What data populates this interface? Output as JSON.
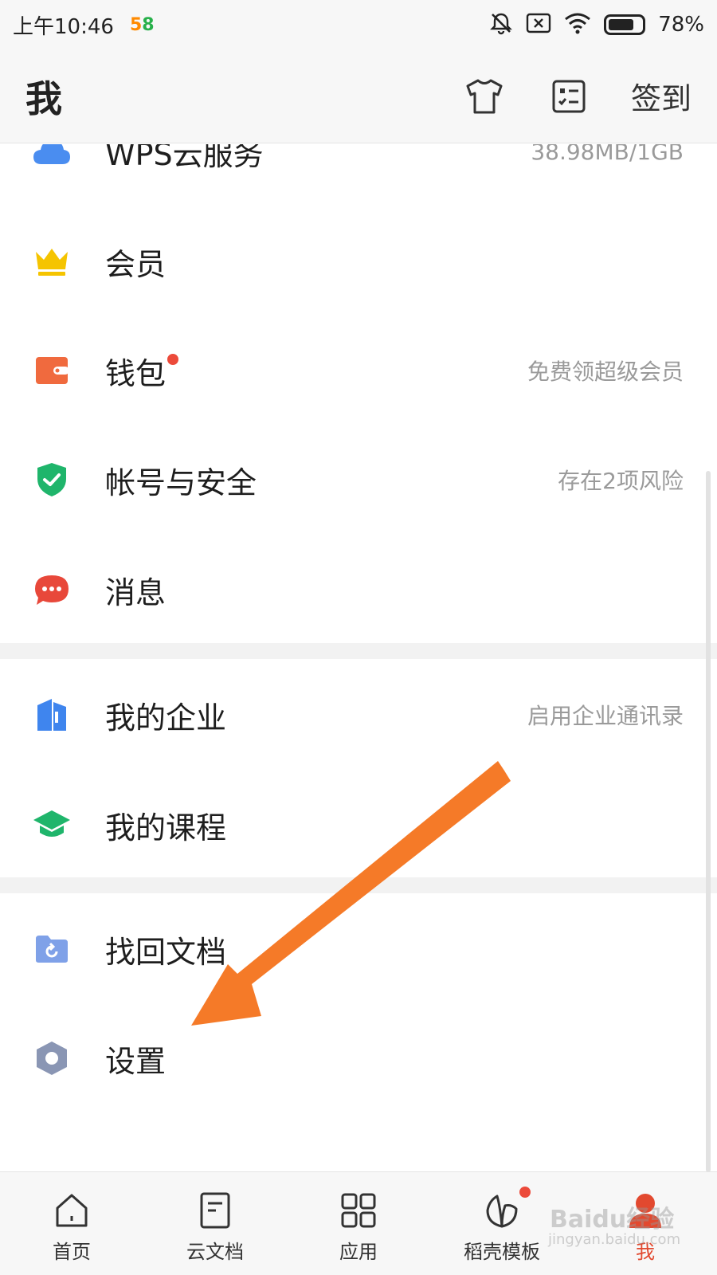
{
  "status_bar": {
    "time": "上午10:46",
    "app_badge": "58",
    "battery_percent": "78%",
    "battery_level": 0.78,
    "icons": [
      "bell-mute-icon",
      "sim-disabled-icon",
      "wifi-icon",
      "battery-icon"
    ]
  },
  "header": {
    "title": "我",
    "actions": {
      "theme_icon": "tshirt-icon",
      "tasks_icon": "checklist-icon",
      "checkin_label": "签到"
    }
  },
  "menu": [
    {
      "icon": "cloud-icon",
      "label": "WPS云服务",
      "value": "38.98MB/1GB",
      "color": "#4a8df0"
    },
    {
      "icon": "crown-icon",
      "label": "会员",
      "value": "",
      "color": "#f5c400"
    },
    {
      "icon": "wallet-icon",
      "label": "钱包",
      "value": "免费领超级会员",
      "badge": true,
      "color": "#f06a3e"
    },
    {
      "icon": "shield-icon",
      "label": "帐号与安全",
      "value": "存在2项风险",
      "color": "#1fb56b"
    },
    {
      "icon": "message-icon",
      "label": "消息",
      "value": "",
      "color": "#e8483a"
    },
    {
      "icon": "enterprise-icon",
      "label": "我的企业",
      "value": "启用企业通讯录",
      "color": "#3f85ee"
    },
    {
      "icon": "course-icon",
      "label": "我的课程",
      "value": "",
      "color": "#1fb56b"
    },
    {
      "icon": "recover-folder-icon",
      "label": "找回文档",
      "value": "",
      "color": "#7fa1e8"
    },
    {
      "icon": "settings-icon",
      "label": "设置",
      "value": "",
      "color": "#8a96b4"
    }
  ],
  "tabs": [
    {
      "icon": "home-icon",
      "label": "首页"
    },
    {
      "icon": "cloud-doc-icon",
      "label": "云文档"
    },
    {
      "icon": "apps-grid-icon",
      "label": "应用"
    },
    {
      "icon": "leaf-icon",
      "label": "稻壳模板",
      "badge": true
    },
    {
      "icon": "person-icon",
      "label": "我",
      "active": true
    }
  ],
  "colors": {
    "accent": "#e2492f",
    "arrow": "#f57a28",
    "secondary_text": "#9a9a9a"
  },
  "watermark": {
    "text": "Baidu经验",
    "sub": "jingyan.baidu.com"
  }
}
